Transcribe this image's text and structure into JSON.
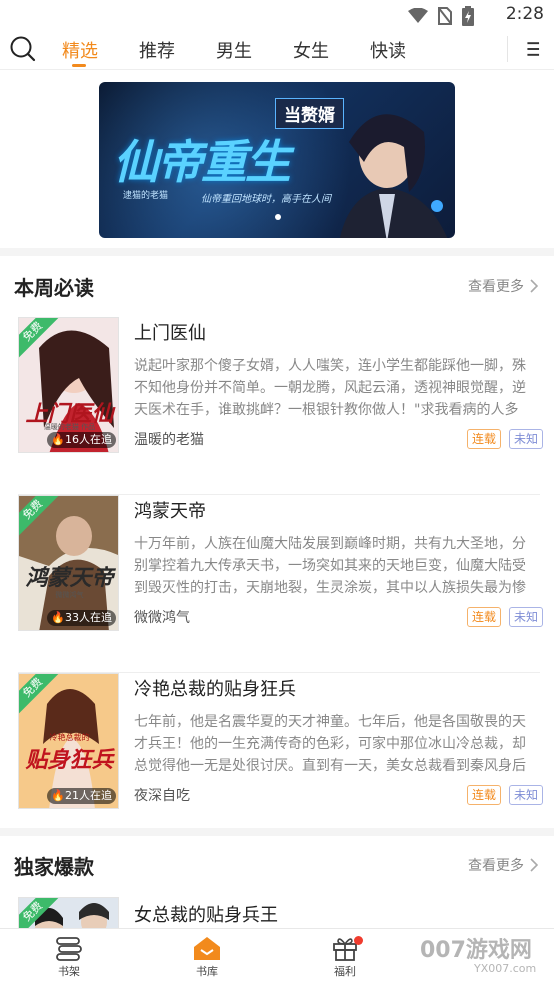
{
  "status_bar": {
    "time": "2:28",
    "icons": [
      "wifi-icon",
      "no-sim-icon",
      "battery-icon"
    ]
  },
  "topnav": {
    "tabs": [
      {
        "label": "精选",
        "active": true
      },
      {
        "label": "推荐",
        "active": false
      },
      {
        "label": "男生",
        "active": false
      },
      {
        "label": "女生",
        "active": false
      },
      {
        "label": "快读",
        "active": false
      }
    ]
  },
  "banner": {
    "tag": "当赘婿",
    "title": "仙帝重生",
    "subtitle": "逮猫的老猫",
    "tagline": "仙帝重回地球时，高手在人间"
  },
  "weekly": {
    "title": "本周必读",
    "more": "查看更多",
    "books": [
      {
        "title": "上门医仙",
        "desc": "说起叶家那个傻子女婿，人人嗤笑，连小学生都能踩他一脚，殊不知他身份并不简单。一朝龙腾，风起云涌，透视神眼觉醒，逆天医术在手，谁敢挑衅？一根银针教你做人！\"求我看病的人多了，天...",
        "author": "温暖的老猫",
        "cover_title": "上门医仙",
        "cover_author": "温暖的老猫 作品",
        "readers": "16人在追",
        "free": "免费",
        "tag_status": "连载",
        "tag_type": "未知"
      },
      {
        "title": "鸿蒙天帝",
        "desc": "十万年前，人族在仙魔大陆发展到巅峰时期，共有九大圣地，分别掌控着九大传承天书，一场突如其来的天地巨变，仙魔大陆受到毁灭性的打击，天崩地裂，生灵涂炭，其中以人族损失最为惨重，...",
        "author": "微微鸿气",
        "cover_title": "鸿蒙天帝",
        "cover_author": "微微鸿气",
        "readers": "33人在追",
        "free": "免费",
        "tag_status": "连载",
        "tag_type": "未知"
      },
      {
        "title": "冷艳总裁的贴身狂兵",
        "desc": "七年前，他是名震华夏的天才神童。七年后，他是各国敬畏的天才兵王！他的一生充满传奇的色彩，可家中那位冰山冷总裁，却总觉得他一无是处很讨厌。直到有一天，美女总裁看到秦风身后跟了...",
        "author": "夜深自吃",
        "cover_title": "贴身狂兵",
        "cover_author": "冷艳总裁的",
        "readers": "21人在追",
        "free": "免费",
        "tag_status": "连载",
        "tag_type": "未知"
      }
    ]
  },
  "exclusive": {
    "title": "独家爆款",
    "more": "查看更多",
    "books": [
      {
        "title": "女总裁的贴身兵王",
        "free": "免费"
      }
    ]
  },
  "bottom_nav": {
    "items": [
      {
        "label": "书架",
        "icon": "bookshelf-icon"
      },
      {
        "label": "书库",
        "icon": "library-home-icon",
        "active": true
      },
      {
        "label": "福利",
        "icon": "gift-icon"
      }
    ]
  },
  "watermark": {
    "text": "007游戏网",
    "url": "YX007.com"
  },
  "colors": {
    "accent": "#f28a1d",
    "free_badge": "#3dba6a",
    "tag_unknown": "#7f8ed6",
    "red_dot": "#f03c2e"
  }
}
